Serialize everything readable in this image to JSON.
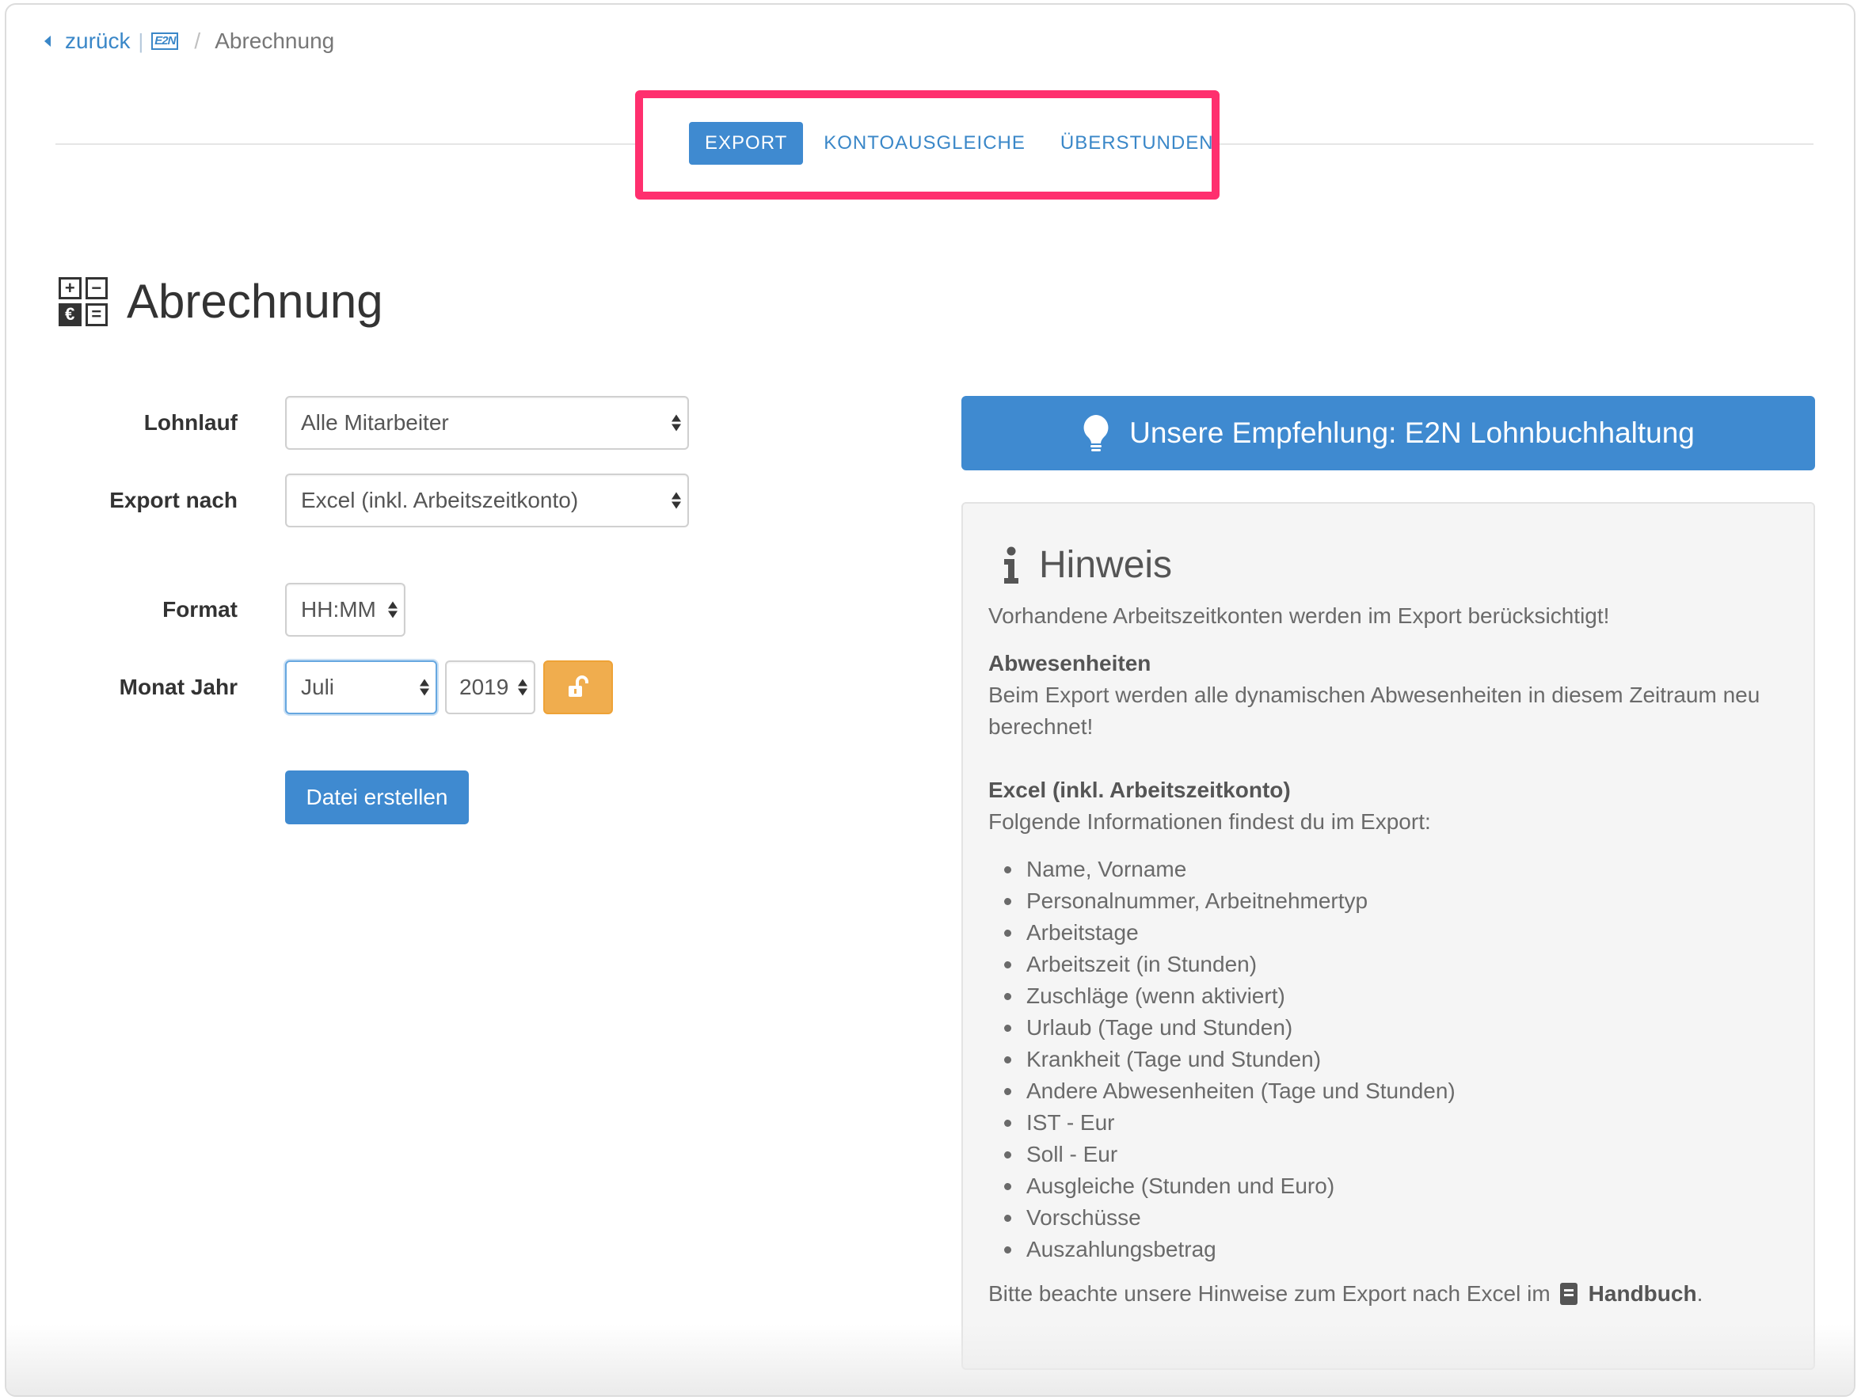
{
  "breadcrumb": {
    "back": "zurück",
    "logo": "E2N",
    "separator": "/",
    "current": "Abrechnung"
  },
  "tabs": [
    {
      "label": "EXPORT",
      "active": true
    },
    {
      "label": "KONTOAUSGLEICHE",
      "active": false
    },
    {
      "label": "ÜBERSTUNDEN",
      "active": false
    }
  ],
  "page": {
    "title": "Abrechnung",
    "icon": "calculator-icon"
  },
  "form": {
    "lohnlauf_label": "Lohnlauf",
    "lohnlauf_value": "Alle Mitarbeiter",
    "export_label": "Export nach",
    "export_value": "Excel (inkl. Arbeitszeitkonto)",
    "format_label": "Format",
    "format_value": "HH:MM",
    "month_year_label": "Monat Jahr",
    "month_value": "Juli",
    "year_value": "2019",
    "lock_icon": "unlock-icon",
    "submit_label": "Datei erstellen"
  },
  "recommendation": {
    "icon": "lightbulb-icon",
    "label": "Unsere Empfehlung: E2N Lohnbuchhaltung"
  },
  "hint": {
    "icon": "info-icon",
    "title": "Hinweis",
    "intro": "Vorhandene Arbeitszeitkonten werden im Export berücksichtigt!",
    "absences_heading": "Abwesenheiten",
    "absences_line1": "Beim Export werden alle dynamischen Abwesenheiten in diesem Zeitraum neu",
    "absences_line2": "berechnet!",
    "excel_heading": "Excel (inkl. Arbeitszeitkonto)",
    "excel_intro": "Folgende Informationen findest du im Export:",
    "items": [
      "Name, Vorname",
      "Personalnummer, Arbeitnehmertyp",
      "Arbeitstage",
      "Arbeitszeit (in Stunden)",
      "Zuschläge (wenn aktiviert)",
      "Urlaub (Tage und Stunden)",
      "Krankheit (Tage und Stunden)",
      "Andere Abwesenheiten (Tage und Stunden)",
      "IST - Eur",
      "Soll - Eur",
      "Ausgleiche (Stunden und Euro)",
      "Vorschüsse",
      "Auszahlungsbetrag"
    ],
    "footer_text": "Bitte beachte unsere Hinweise zum Export nach Excel im",
    "footer_icon": "book-icon",
    "footer_link": "Handbuch",
    "footer_end": "."
  },
  "colors": {
    "primary": "#3f8ad0",
    "link": "#3a87c8",
    "warning": "#f0ad4e",
    "highlight": "#ff2f6e"
  }
}
